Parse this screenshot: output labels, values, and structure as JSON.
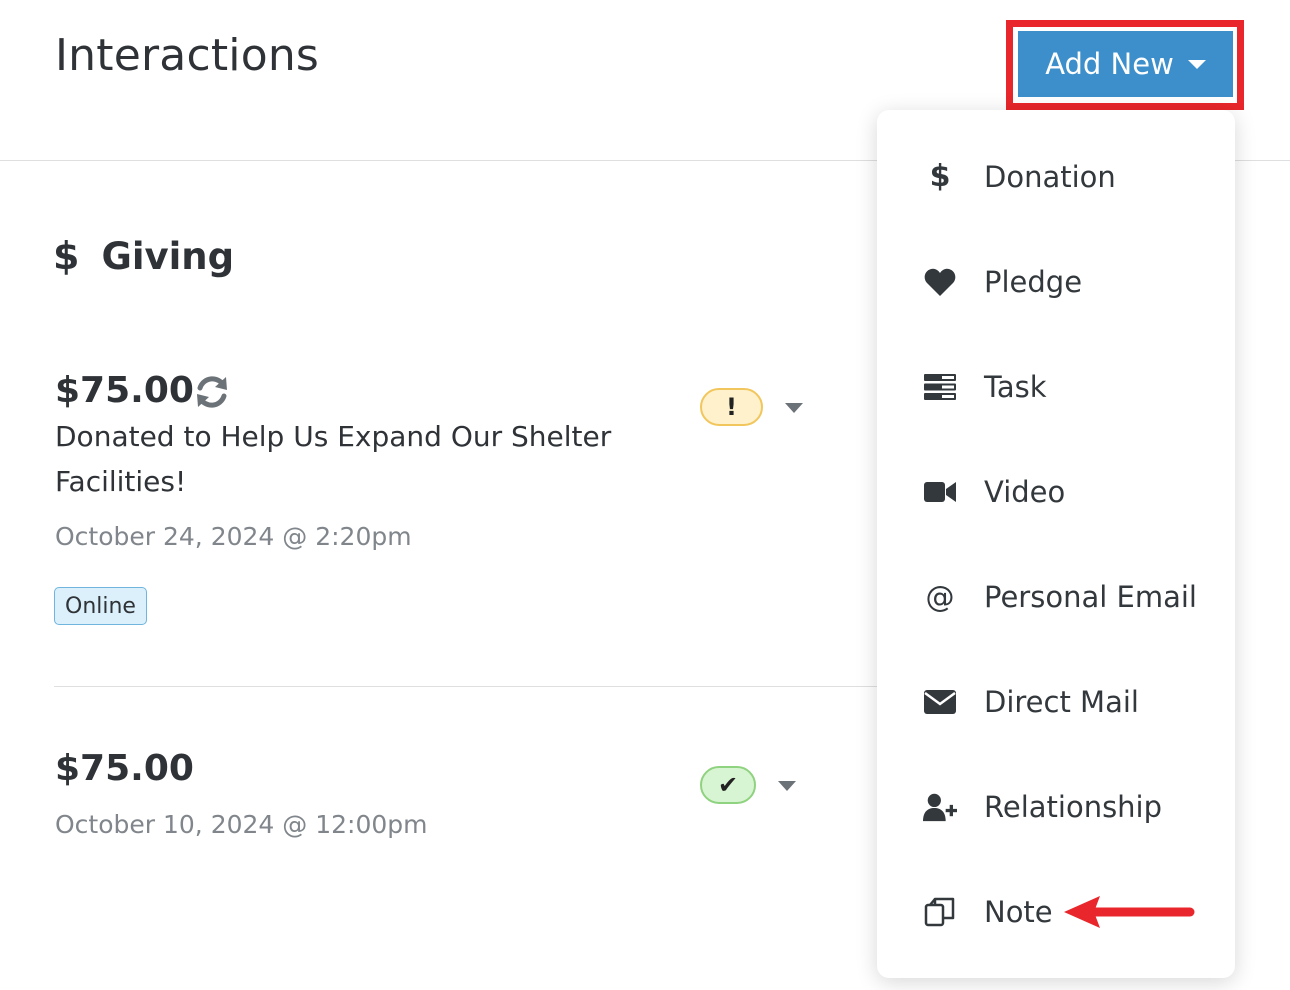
{
  "header": {
    "title": "Interactions",
    "add_new_label": "Add New"
  },
  "section": {
    "icon": "dollar-icon",
    "title": "Giving"
  },
  "entries": [
    {
      "amount": "$75.00",
      "description": "Donated to Help Us Expand Our Shelter Facilities!",
      "date": "October 24, 2024 @ 2:20pm",
      "badge": "Online",
      "status": "warning",
      "status_symbol": "!",
      "recurring": true
    },
    {
      "amount": "$75.00",
      "date": "October 10, 2024 @ 12:00pm",
      "status": "ok",
      "status_symbol": "✔",
      "recurring": false
    }
  ],
  "menu": {
    "items": [
      {
        "label": "Donation",
        "icon": "dollar-icon"
      },
      {
        "label": "Pledge",
        "icon": "heart-icon"
      },
      {
        "label": "Task",
        "icon": "task-list-icon"
      },
      {
        "label": "Video",
        "icon": "video-camera-icon"
      },
      {
        "label": "Personal Email",
        "icon": "at-sign-icon"
      },
      {
        "label": "Direct Mail",
        "icon": "envelope-icon"
      },
      {
        "label": "Relationship",
        "icon": "user-plus-icon"
      },
      {
        "label": "Note",
        "icon": "note-copy-icon"
      }
    ]
  },
  "colors": {
    "accent": "#3d8fcb",
    "highlight": "#e8262b",
    "warning_bg": "#fff1cc",
    "ok_bg": "#d8f5d3",
    "badge_bg": "#dcf0fb"
  }
}
